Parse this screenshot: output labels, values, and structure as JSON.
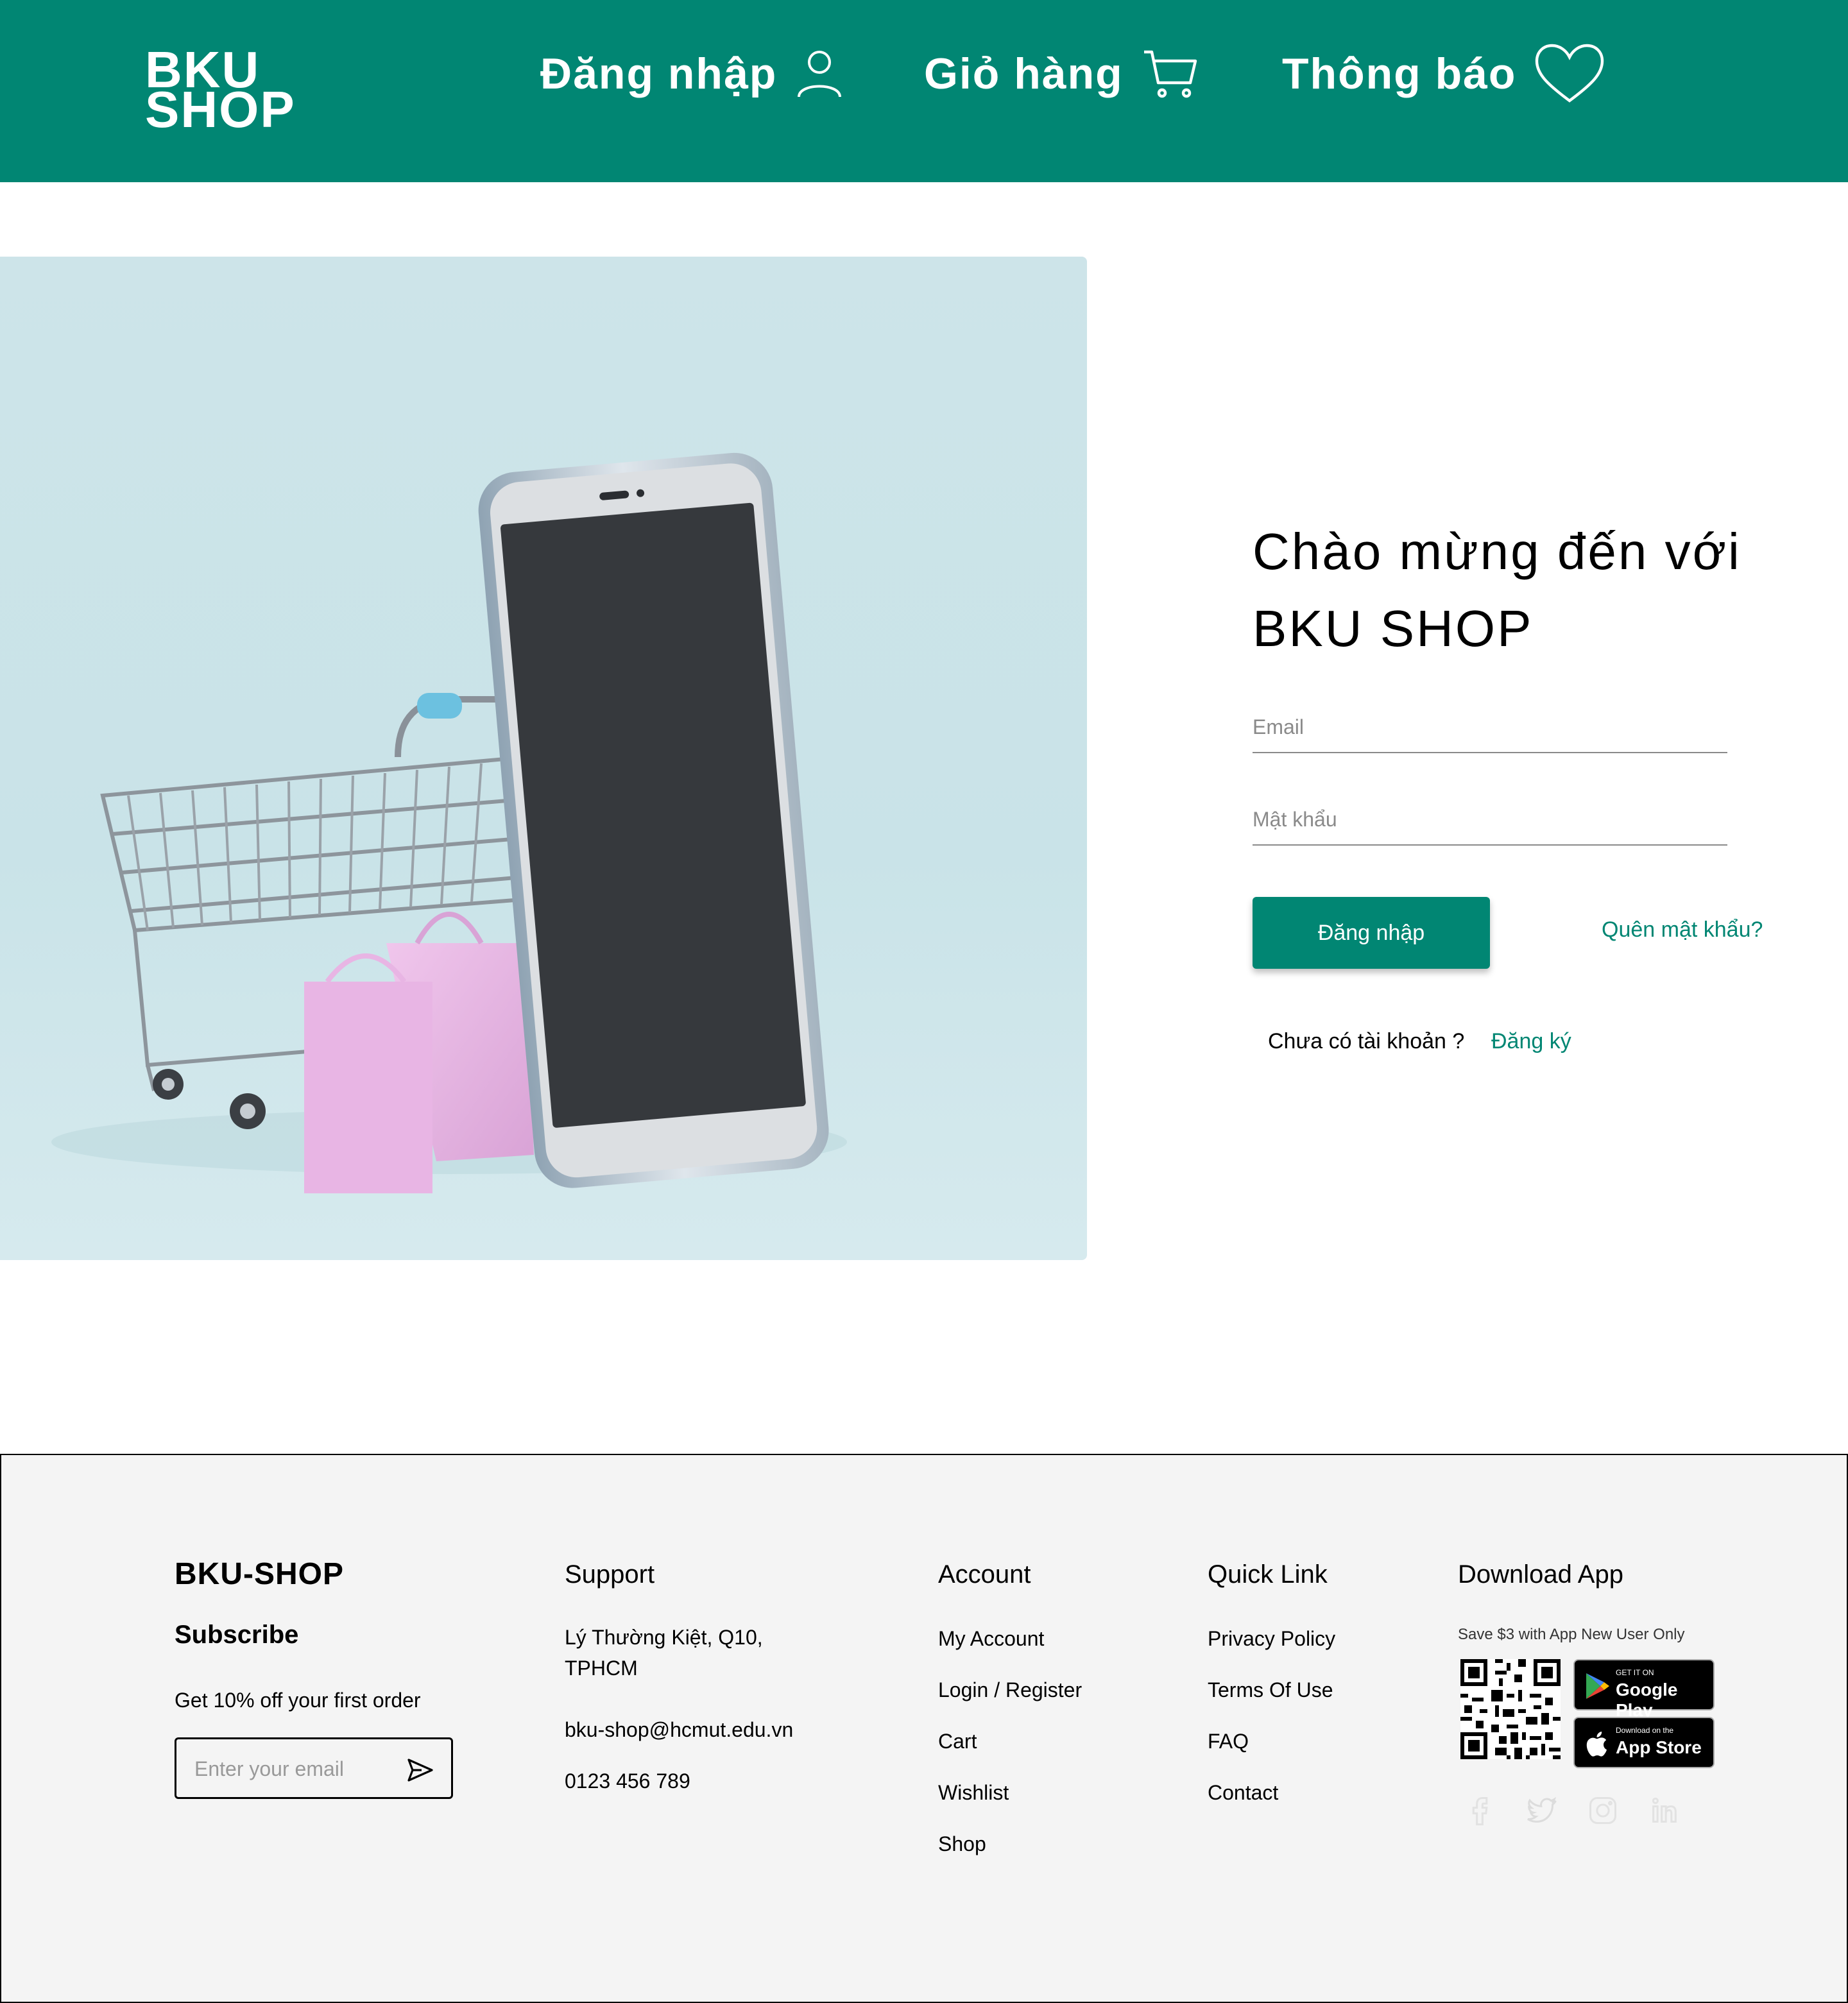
{
  "header": {
    "logo_line1": "BKU",
    "logo_line2": "SHOP",
    "nav": {
      "login": "Đăng nhập",
      "cart": "Giỏ hàng",
      "notify": "Thông báo"
    }
  },
  "login_form": {
    "welcome_line1": "Chào mừng đến với",
    "welcome_line2": "BKU SHOP",
    "email_placeholder": "Email",
    "password_placeholder": "Mật khẩu",
    "submit_label": "Đăng nhập",
    "forgot_label": "Quên mật khẩu?",
    "no_account_text": "Chưa có tài khoản ?",
    "register_label": "Đăng ký"
  },
  "footer": {
    "brand": "BKU-SHOP",
    "subscribe_title": "Subscribe",
    "offer_text": "Get 10% off your first order",
    "subscribe_placeholder": "Enter your email",
    "support": {
      "title": "Support",
      "address_line1": "Lý Thường Kiệt, Q10,",
      "address_line2": "TPHCM",
      "email": "bku-shop@hcmut.edu.vn",
      "phone": "0123 456 789"
    },
    "account": {
      "title": "Account",
      "links": [
        "My Account",
        "Login / Register",
        "Cart",
        "Wishlist",
        "Shop"
      ]
    },
    "quick_link": {
      "title": "Quick Link",
      "links": [
        "Privacy Policy",
        "Terms Of Use",
        "FAQ",
        "Contact"
      ]
    },
    "download_app": {
      "title": "Download App",
      "note": "Save $3 with App New User Only",
      "google_play_small": "GET IT ON",
      "google_play_big": "Google Play",
      "app_store_small": "Download on the",
      "app_store_big": "App Store"
    },
    "social_icons": [
      "facebook-icon",
      "twitter-icon",
      "instagram-icon",
      "linkedin-icon"
    ]
  },
  "colors": {
    "brand": "#018673",
    "footer_bg": "#f4f4f4",
    "hero_bg": "#cde4e9"
  }
}
